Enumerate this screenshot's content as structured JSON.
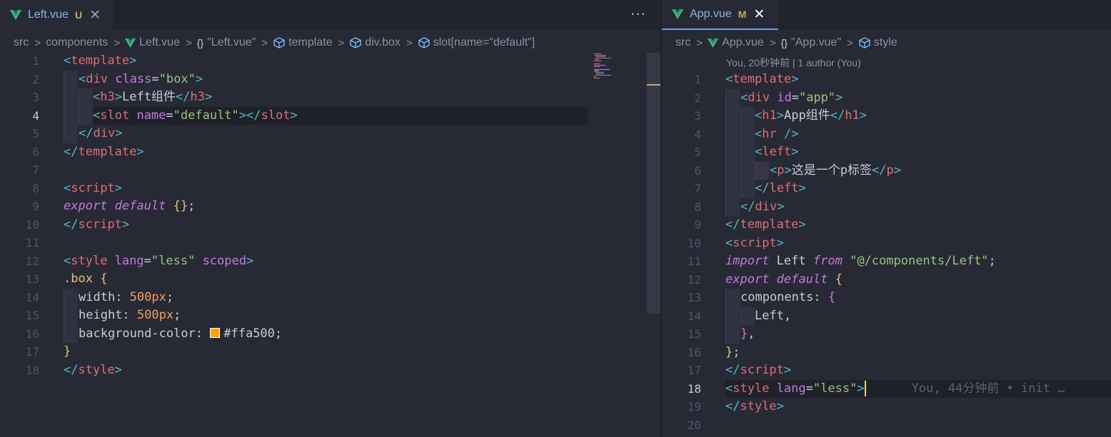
{
  "left_editor": {
    "tab": {
      "name": "Left.vue",
      "badge": "U",
      "close": "✕"
    },
    "more": "···",
    "breadcrumb": [
      "src",
      "components",
      "Left.vue",
      "\"Left.vue\"",
      "template",
      "div.box",
      "slot[name=\"default\"]"
    ],
    "active_line": 4,
    "line_numbers": [
      "1",
      "2",
      "3",
      "4",
      "5",
      "6",
      "7",
      "8",
      "9",
      "10",
      "11",
      "12",
      "13",
      "14",
      "15",
      "16",
      "17",
      "18"
    ]
  },
  "right_editor": {
    "tab": {
      "name": "App.vue",
      "badge": "M",
      "close": "✕"
    },
    "breadcrumb": [
      "src",
      "App.vue",
      "\"App.vue\"",
      "style"
    ],
    "codelens": "You, 20秒钟前 | 1 author (You)",
    "active_line": 18,
    "blame": "You, 44分钟前 • init …",
    "line_numbers": [
      "1",
      "2",
      "3",
      "4",
      "5",
      "6",
      "7",
      "8",
      "9",
      "10",
      "11",
      "12",
      "13",
      "14",
      "15",
      "16",
      "17",
      "18",
      "19",
      "20"
    ]
  },
  "colors": {
    "background": "#272a35",
    "tag": "#e06c75",
    "attribute": "#c678dd",
    "string": "#98c379",
    "number": "#ef9f5c",
    "swatch": "#ffa500"
  },
  "text": {
    "l_template": "template",
    "l_div": "div",
    "l_class": "class",
    "l_box": "\"box\"",
    "l_h3": "h3",
    "l_h3_text": "Left组件",
    "l_slot": "slot",
    "l_name": "name",
    "l_default": "\"default\"",
    "l_script": "script",
    "l_export": "export",
    "l_default_kw": "default",
    "l_braces": "{}",
    "l_style": "style",
    "l_lang": "lang",
    "l_less": "\"less\"",
    "l_scoped": "scoped",
    "l_boxsel": ".box",
    "l_width": "width",
    "l_height": "height",
    "l_bg": "background-color",
    "l_500": "500px",
    "l_color": "#ffa500",
    "r_id": "id",
    "r_app": "\"app\"",
    "r_h1": "h1",
    "r_h1_text": "App组件",
    "r_hr": "hr",
    "r_left": "left",
    "r_p": "p",
    "r_p_text": "这是一个p标签",
    "r_import": "import",
    "r_Left": "Left",
    "r_from": "from",
    "r_path": "\"@/components/Left\"",
    "r_components": "components"
  }
}
